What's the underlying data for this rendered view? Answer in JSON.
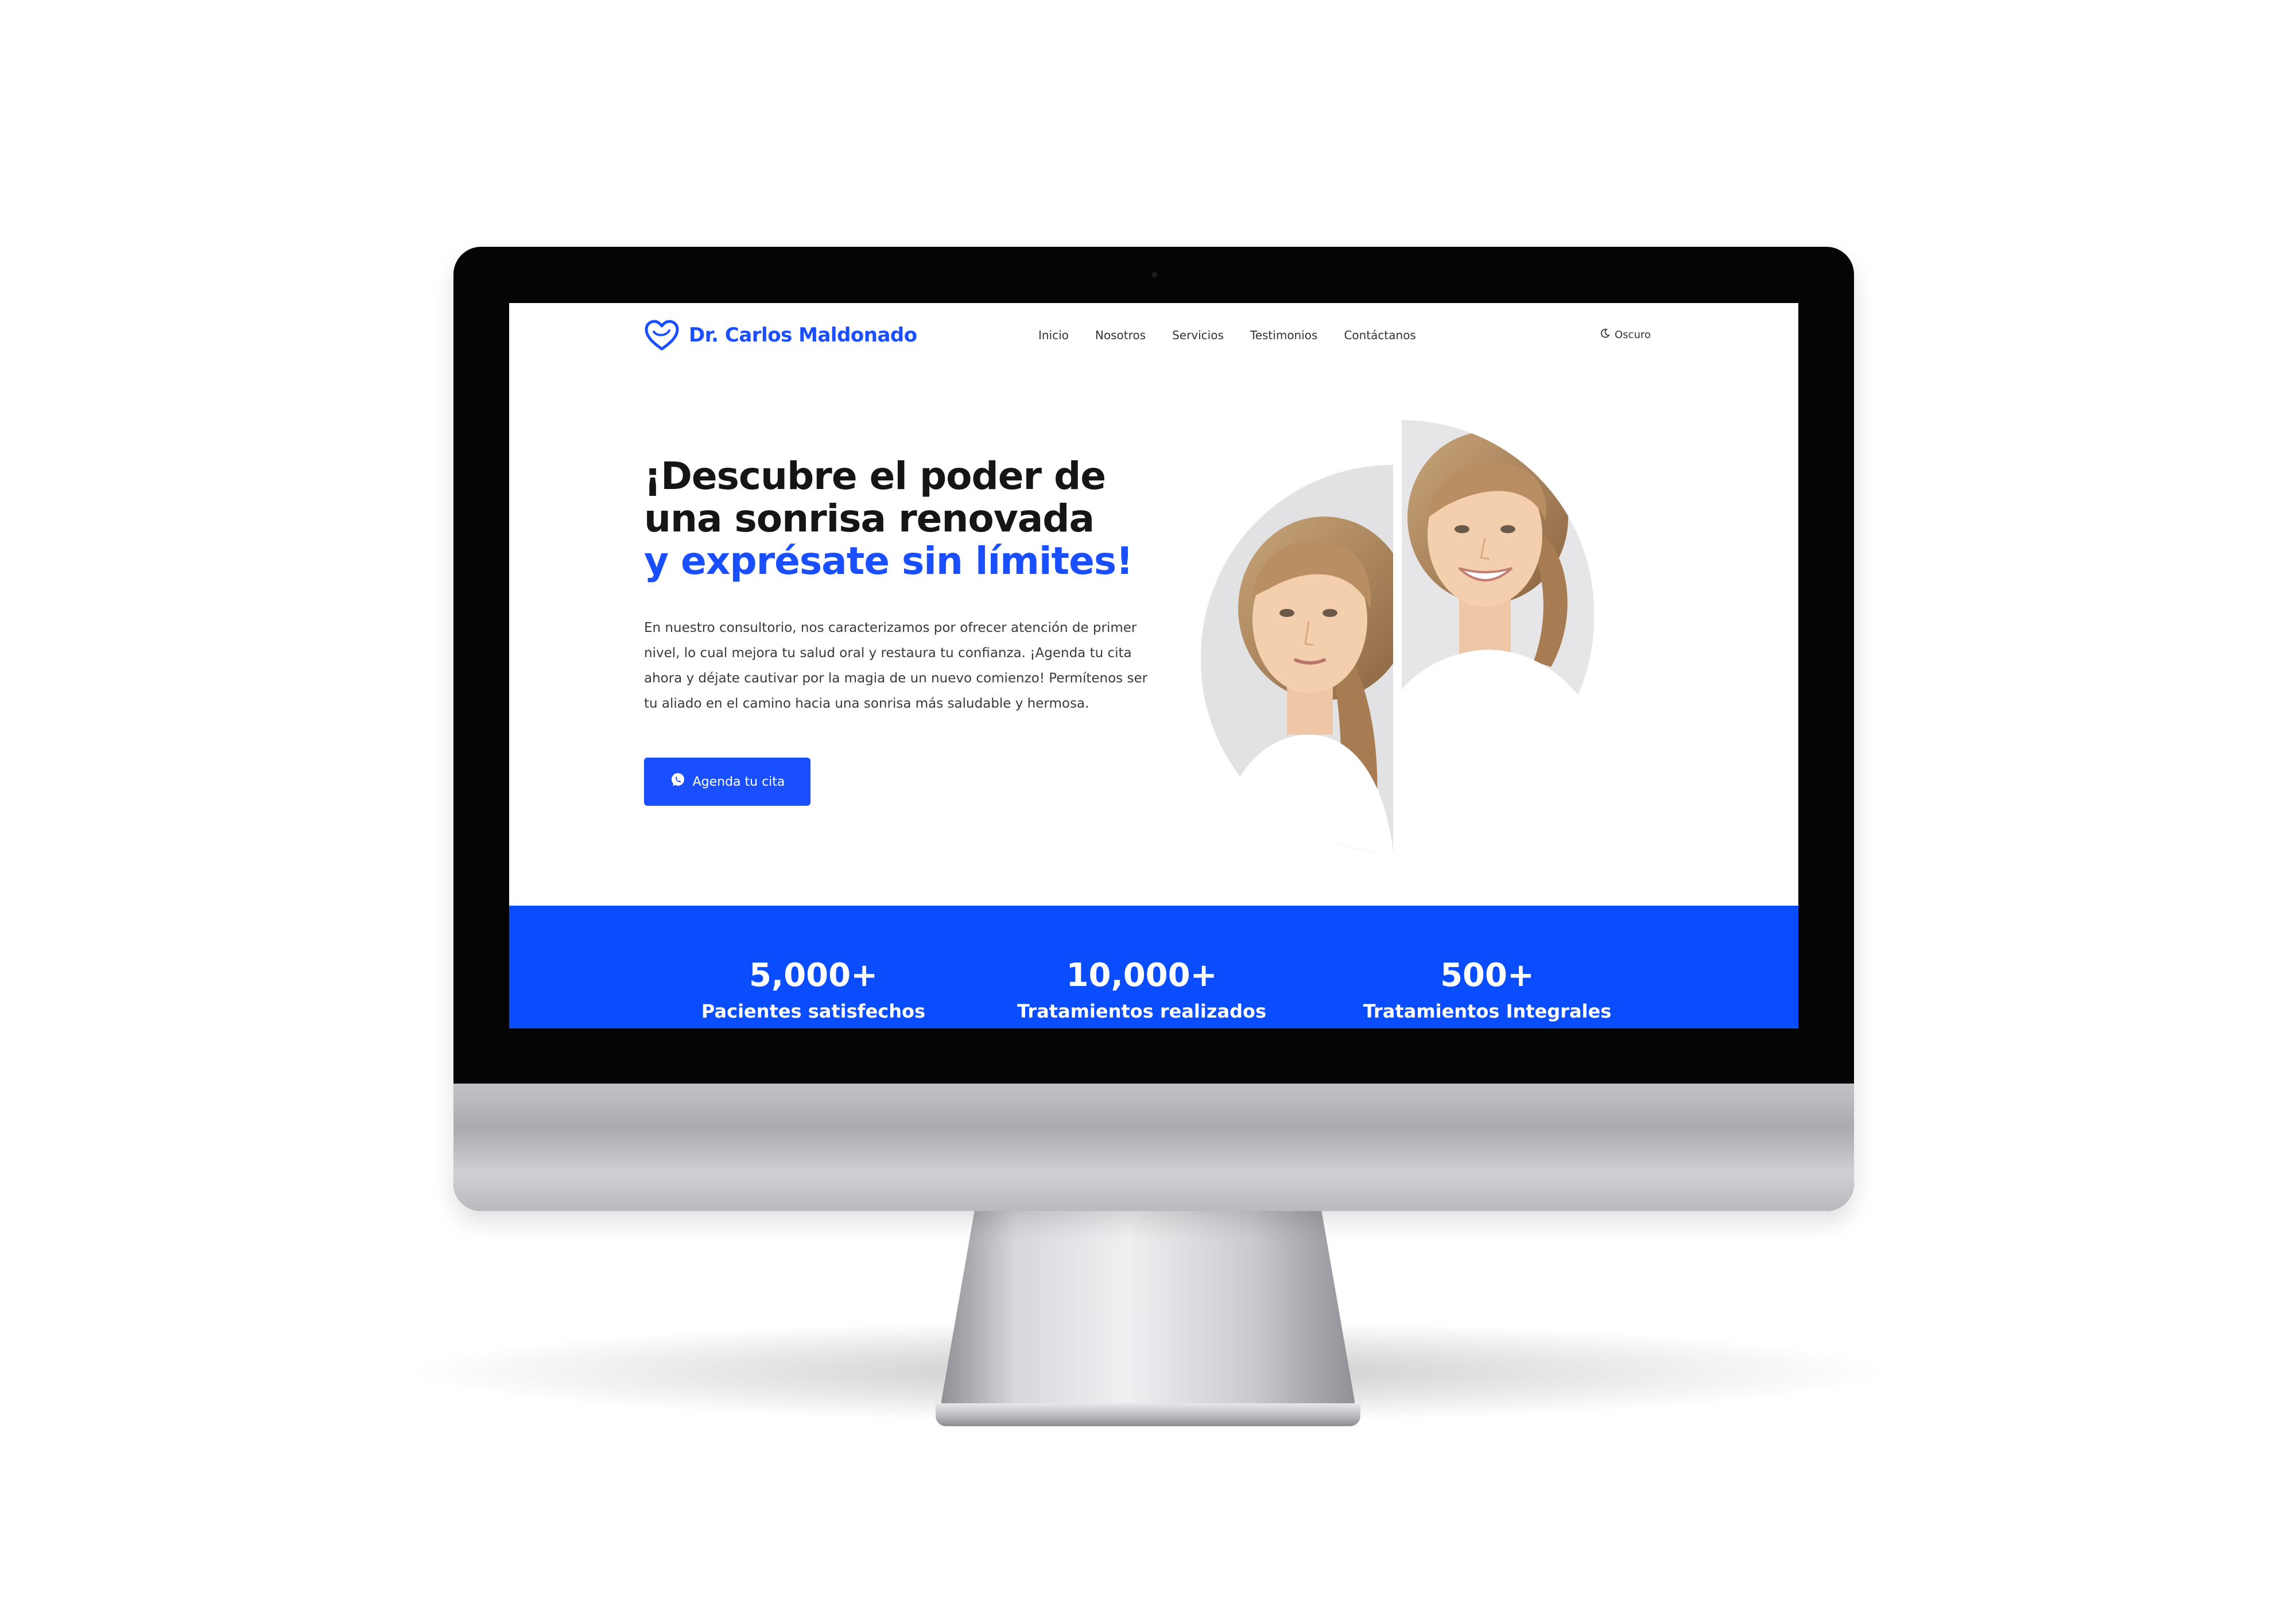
{
  "site": {
    "brand_name": "Dr. Carlos Maldonado",
    "brand_icon": "tooth-heart-icon"
  },
  "nav": {
    "items": [
      "Inicio",
      "Nosotros",
      "Servicios",
      "Testimonios",
      "Contáctanos"
    ],
    "theme_toggle": "Oscuro",
    "theme_icon": "moon-icon"
  },
  "hero": {
    "title_line1": "¡Descubre el poder de",
    "title_line2": "una sonrisa renovada",
    "title_accent": "y exprésate sin límites!",
    "description": "En nuestro consultorio, nos caracterizamos por ofrecer atención de primer nivel, lo cual mejora tu salud oral y restaura tu confianza. ¡Agenda tu cita ahora y déjate cautivar por la magia de un nuevo comienzo! Permítenos ser tu aliado en el camino hacia una sonrisa más saludable y hermosa.",
    "cta_label": "Agenda tu cita",
    "cta_icon": "whatsapp-icon"
  },
  "stats": [
    {
      "value": "5,000+",
      "label": "Pacientes satisfechos"
    },
    {
      "value": "10,000+",
      "label": "Tratamientos realizados"
    },
    {
      "value": "500+",
      "label": "Tratamientos Integrales"
    }
  ],
  "colors": {
    "accent": "#1a4fff",
    "stats_band": "#0a4dff",
    "text_dark": "#151515"
  }
}
